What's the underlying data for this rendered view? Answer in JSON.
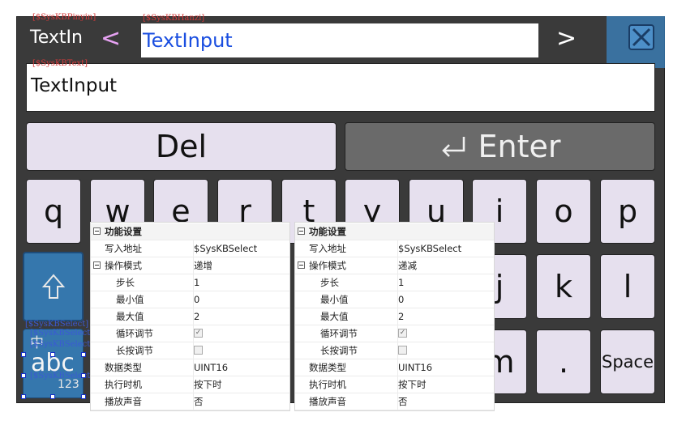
{
  "tags": {
    "pinyin": "[$SysKBPinyin]",
    "hanzi": "[$SysKBHanzi]",
    "text": "[$SysKBText]",
    "select1": "[$SysKBSelect]",
    "select2": "[$SysKBSelect]",
    "select3": "[$SysKBSelect]",
    "select4": "[$SysKBSelect]"
  },
  "header": {
    "pinyin_text": "TextIn",
    "left_arrow": "<",
    "hanzi_input": "TextInput",
    "right_arrow": ">"
  },
  "input": {
    "value": "TextInput"
  },
  "keys": {
    "del": "Del",
    "enter_icon": "⏎",
    "enter": "Enter",
    "letters": [
      "q",
      "w",
      "e",
      "r",
      "t",
      "y",
      "u",
      "i",
      "o",
      "p"
    ],
    "row3_visible": [
      "j",
      "k",
      "l"
    ],
    "row4_visible": [
      "m",
      "."
    ],
    "space": "Space",
    "shift_icon": "⇧",
    "zh": "中",
    "abc": "abc",
    "num": "123"
  },
  "panels": [
    {
      "section": "功能设置",
      "rows": [
        {
          "label": "写入地址",
          "value": "$SysKBSelect"
        },
        {
          "label": "操作模式",
          "value": "递增",
          "toggle": true
        },
        {
          "label": "步长",
          "value": "1",
          "indent": true
        },
        {
          "label": "最小值",
          "value": "0",
          "indent": true
        },
        {
          "label": "最大值",
          "value": "2",
          "indent": true
        },
        {
          "label": "循环调节",
          "check": true,
          "checked": true,
          "indent": true
        },
        {
          "label": "长按调节",
          "check": true,
          "checked": false,
          "indent": true
        },
        {
          "label": "数据类型",
          "value": "UINT16"
        },
        {
          "label": "执行时机",
          "value": "按下时"
        },
        {
          "label": "播放声音",
          "value": "否"
        }
      ]
    },
    {
      "section": "功能设置",
      "rows": [
        {
          "label": "写入地址",
          "value": "$SysKBSelect"
        },
        {
          "label": "操作模式",
          "value": "递减",
          "toggle": true
        },
        {
          "label": "步长",
          "value": "1",
          "indent": true
        },
        {
          "label": "最小值",
          "value": "0",
          "indent": true
        },
        {
          "label": "最大值",
          "value": "2",
          "indent": true
        },
        {
          "label": "循环调节",
          "check": true,
          "checked": true,
          "indent": true
        },
        {
          "label": "长按调节",
          "check": true,
          "checked": false,
          "indent": true
        },
        {
          "label": "数据类型",
          "value": "UINT16"
        },
        {
          "label": "执行时机",
          "value": "按下时"
        },
        {
          "label": "播放声音",
          "value": "否"
        }
      ]
    }
  ],
  "colors": {
    "keyboard_bg": "#3a3a3a",
    "key_bg": "#e6e0ee",
    "enter_bg": "#6a6a6a",
    "mode_key_bg": "#3577ad",
    "hanzi_text": "#1a4ee0",
    "tag_red": "#d43a3a"
  }
}
